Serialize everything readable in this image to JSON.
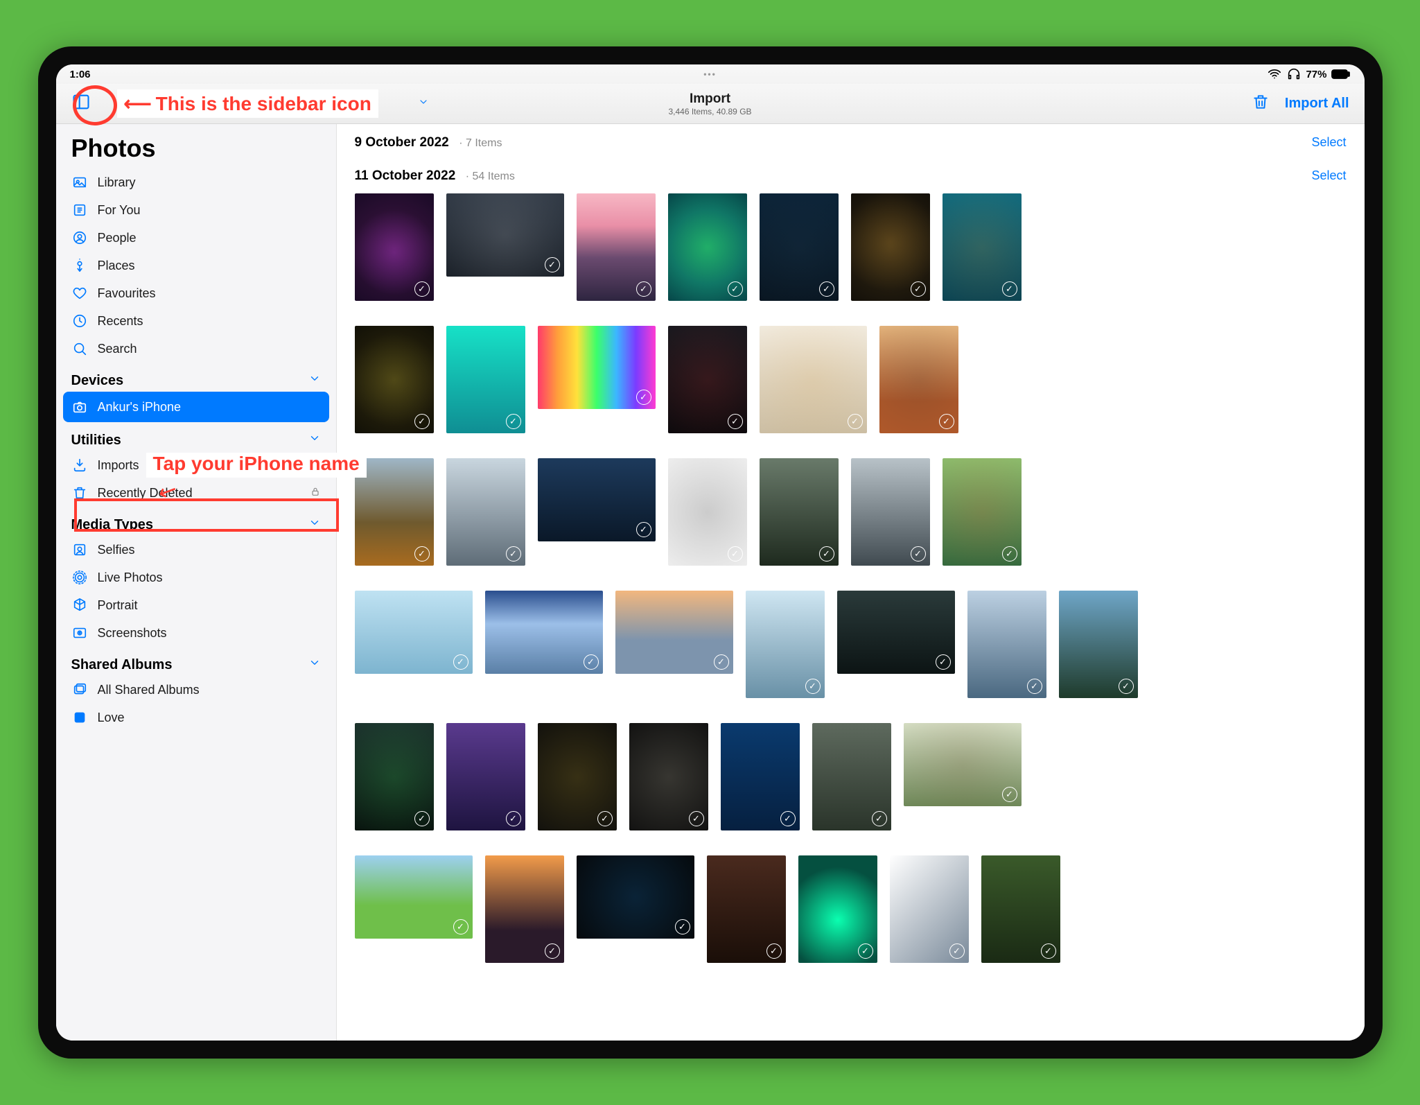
{
  "status": {
    "time": "1:06",
    "battery_pct": "77%"
  },
  "navbar": {
    "title": "Import",
    "subtitle": "3,446 Items, 40.89 GB",
    "import_all": "Import All"
  },
  "annotations": {
    "sidebar_icon_label": "This is the sidebar icon",
    "tap_device_label": "Tap your iPhone name"
  },
  "sidebar": {
    "title": "Photos",
    "items": [
      {
        "icon": "library",
        "label": "Library"
      },
      {
        "icon": "foryou",
        "label": "For You"
      },
      {
        "icon": "people",
        "label": "People"
      },
      {
        "icon": "places",
        "label": "Places"
      },
      {
        "icon": "heart",
        "label": "Favourites"
      },
      {
        "icon": "clock",
        "label": "Recents"
      },
      {
        "icon": "search",
        "label": "Search"
      }
    ],
    "devices_header": "Devices",
    "device_item": {
      "icon": "camera",
      "label": "Ankur's iPhone"
    },
    "utilities_header": "Utilities",
    "utilities": [
      {
        "icon": "import",
        "label": "Imports"
      },
      {
        "icon": "trash",
        "label": "Recently Deleted",
        "locked": true
      }
    ],
    "media_types_header": "Media Types",
    "media_types": [
      {
        "icon": "selfie",
        "label": "Selfies"
      },
      {
        "icon": "livephoto",
        "label": "Live Photos"
      },
      {
        "icon": "cube",
        "label": "Portrait"
      },
      {
        "icon": "screenshot",
        "label": "Screenshots"
      }
    ],
    "shared_header": "Shared Albums",
    "shared": [
      {
        "icon": "shared",
        "label": "All Shared Albums"
      },
      {
        "icon": "thumb",
        "label": "Love"
      }
    ]
  },
  "groups": [
    {
      "date": "9 October 2022",
      "count_label": "7 Items",
      "select_label": "Select"
    },
    {
      "date": "11 October 2022",
      "count_label": "54 Items",
      "select_label": "Select"
    }
  ],
  "thumbnails_row1": [
    {
      "shape": "portrait",
      "bg": "radial-gradient(circle at 50% 55%, #4a1a66 0%, #120820 60%)",
      "accent": "#ff4fd8"
    },
    {
      "shape": "short",
      "bg": "linear-gradient(#2b3440,#141a22)",
      "accent": "#cfd4da"
    },
    {
      "shape": "portrait",
      "bg": "linear-gradient(#f7b7c4 0%,#e98fa7 30%,#6a4a6f 60%,#2e2540 100%)"
    },
    {
      "shape": "portrait",
      "bg": "radial-gradient(circle at 50% 50%, #0aa06f 0%, #036a69 55%, #024048 100%)",
      "accent": "#7be34e"
    },
    {
      "shape": "portrait",
      "bg": "linear-gradient(#0b2236,#08141f)",
      "accent": "#294a62"
    },
    {
      "shape": "portrait",
      "bg": "radial-gradient(circle at 50% 45%, #3a2a10 0%, #0c0a07 70%)",
      "accent": "#e1b04a"
    },
    {
      "shape": "portrait",
      "bg": "linear-gradient(#0a687f,#044053)",
      "accent": "#d8a23c"
    }
  ],
  "thumbnails_row2": [
    {
      "shape": "portrait",
      "bg": "radial-gradient(circle at 50% 50%, #2a2a0e 0%, #0a0a05 70%)",
      "accent": "#e6c23a"
    },
    {
      "shape": "portrait",
      "bg": "linear-gradient(#17e1c7,#0f8e93)"
    },
    {
      "shape": "short",
      "bg": "linear-gradient(90deg,#ff3b6b,#ff9e3b,#ffe13b,#3bff6b,#3bb7ff,#7b3bff,#ff3bd1)"
    },
    {
      "shape": "portrait",
      "bg": "linear-gradient(#12171d,#05080b)",
      "accent": "#e03b3b"
    },
    {
      "shape": "sq",
      "bg": "linear-gradient(#f2ede3,#cbbfa7)",
      "accent": "#d9a24a"
    },
    {
      "shape": "portrait",
      "bg": "linear-gradient(#e9b77e 0%, #b45a2a 70%)",
      "accent": "#2b2b2b"
    }
  ],
  "thumbnails_row3": [
    {
      "shape": "portrait",
      "bg": "linear-gradient(#9fb7c7 0%, #6f5a2e 60%, #a86b1f 100%)"
    },
    {
      "shape": "portrait",
      "bg": "linear-gradient(#c9d6df,#5e6c77)"
    },
    {
      "shape": "short",
      "bg": "linear-gradient(#1d3a5c 0%, #0a1828 100%)"
    },
    {
      "shape": "portrait",
      "bg": "#f4f4f4",
      "accent": "#2b2b2b"
    },
    {
      "shape": "portrait",
      "bg": "linear-gradient(#697a6a 0%, #1e2a1e 100%)"
    },
    {
      "shape": "portrait",
      "bg": "linear-gradient(#b8c2c8 0%, #404a50 100%)"
    },
    {
      "shape": "portrait",
      "bg": "linear-gradient(#8abf6e 0%, #2e6b3e 100%)",
      "accent": "#e0512f"
    }
  ],
  "thumbnails_row4": [
    {
      "shape": "short",
      "bg": "linear-gradient(#bfe2f2,#7db4cf)"
    },
    {
      "shape": "short",
      "bg": "linear-gradient(#2a4e8e 0%, #9cbfe8 40%, #5a7fa6 100%)"
    },
    {
      "shape": "short",
      "bg": "linear-gradient(#f2b77e 0%, #7d94ad 60%)"
    },
    {
      "shape": "portrait",
      "bg": "linear-gradient(#cfe6f2,#6890a6)"
    },
    {
      "shape": "short",
      "bg": "linear-gradient(#2a3a3a 0%, #0c1414 100%)"
    },
    {
      "shape": "portrait",
      "bg": "linear-gradient(#bcd0e2,#4a6880)"
    },
    {
      "shape": "portrait",
      "bg": "linear-gradient(#6fa6c8 0%, #1e3a2a 100%)"
    }
  ],
  "thumbnails_row5": [
    {
      "shape": "portrait",
      "bg": "linear-gradient(#1a2a2a,#060b0b)",
      "accent": "#4aff6b"
    },
    {
      "shape": "portrait",
      "bg": "linear-gradient(#5a3a8e,#1e1440)"
    },
    {
      "shape": "portrait",
      "bg": "#0b0b0b",
      "accent": "#e6c33a"
    },
    {
      "shape": "portrait",
      "bg": "#0b0b0b",
      "accent": "#e6e0c8"
    },
    {
      "shape": "portrait",
      "bg": "linear-gradient(#0a3a6e,#062040)"
    },
    {
      "shape": "portrait",
      "bg": "linear-gradient(#5e6a5e,#2a342a)"
    },
    {
      "shape": "short",
      "bg": "linear-gradient(#d8e2c8 0%, #6e8a5a 100%)",
      "accent": "#6b4a2a"
    }
  ],
  "thumbnails_row6": [
    {
      "shape": "short",
      "bg": "linear-gradient(#9dd0f0 0%, #6fbf4a 60%)"
    },
    {
      "shape": "portrait",
      "bg": "linear-gradient(#f29b4a 0%, #2a1a2a 70%)"
    },
    {
      "shape": "short",
      "bg": "#050505",
      "accent": "#1e9bff"
    },
    {
      "shape": "portrait",
      "bg": "linear-gradient(#4a2a1e,#1a0e08)"
    },
    {
      "shape": "portrait",
      "bg": "radial-gradient(circle at 50% 60%, #0affb0 0%, #055040 70%)"
    },
    {
      "shape": "portrait",
      "bg": "linear-gradient(135deg,#ffffff 0%, #7a8a9a 100%)"
    },
    {
      "shape": "portrait",
      "bg": "linear-gradient(#3a5a2a 0%, #1a2a14 100%)"
    }
  ]
}
